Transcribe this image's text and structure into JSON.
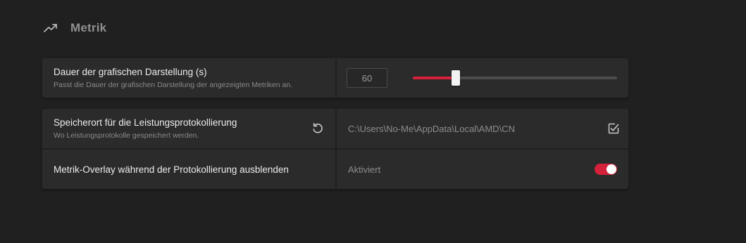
{
  "section": {
    "title": "Metrik",
    "icon": "trending-up-icon"
  },
  "duration": {
    "title": "Dauer der grafischen Darstellung (s)",
    "description": "Passt die Dauer der grafischen Darstellung der angezeigten Metriken an.",
    "value": "60",
    "slider_fraction": 0.21
  },
  "log_location": {
    "title": "Speicherort für die Leistungsprotokollierung",
    "description": "Wo Leistungsprotokolle gespeichert werden.",
    "path": "C:\\Users\\No-Me\\AppData\\Local\\AMD\\CN",
    "reset_icon": "reset-icon",
    "browse_icon": "folder-browse-icon"
  },
  "overlay": {
    "title": "Metrik-Overlay während der Protokollierung ausblenden",
    "status": "Aktiviert",
    "enabled": true
  },
  "colors": {
    "accent": "#d6213b",
    "background": "#202020",
    "card": "#2b2b2b"
  }
}
